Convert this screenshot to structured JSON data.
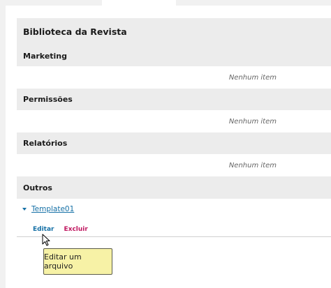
{
  "library": {
    "title": "Biblioteca da Revista",
    "sections": [
      {
        "title": "Marketing",
        "empty_text": "Nenhum item"
      },
      {
        "title": "Permissões",
        "empty_text": "Nenhum item"
      },
      {
        "title": "Relatórios",
        "empty_text": "Nenhum item"
      },
      {
        "title": "Outros"
      }
    ],
    "file": {
      "name": "Template01",
      "actions": {
        "edit": "Editar",
        "delete": "Excluir"
      }
    }
  },
  "tooltip": {
    "text": "Editar um arquivo"
  },
  "colors": {
    "header_bg": "#ececec",
    "link": "#1570a6",
    "delete": "#c0165f",
    "tooltip_bg": "#f7f2a6"
  },
  "icons": {
    "expand": "caret-down-icon",
    "pointer": "mouse-cursor-icon"
  }
}
